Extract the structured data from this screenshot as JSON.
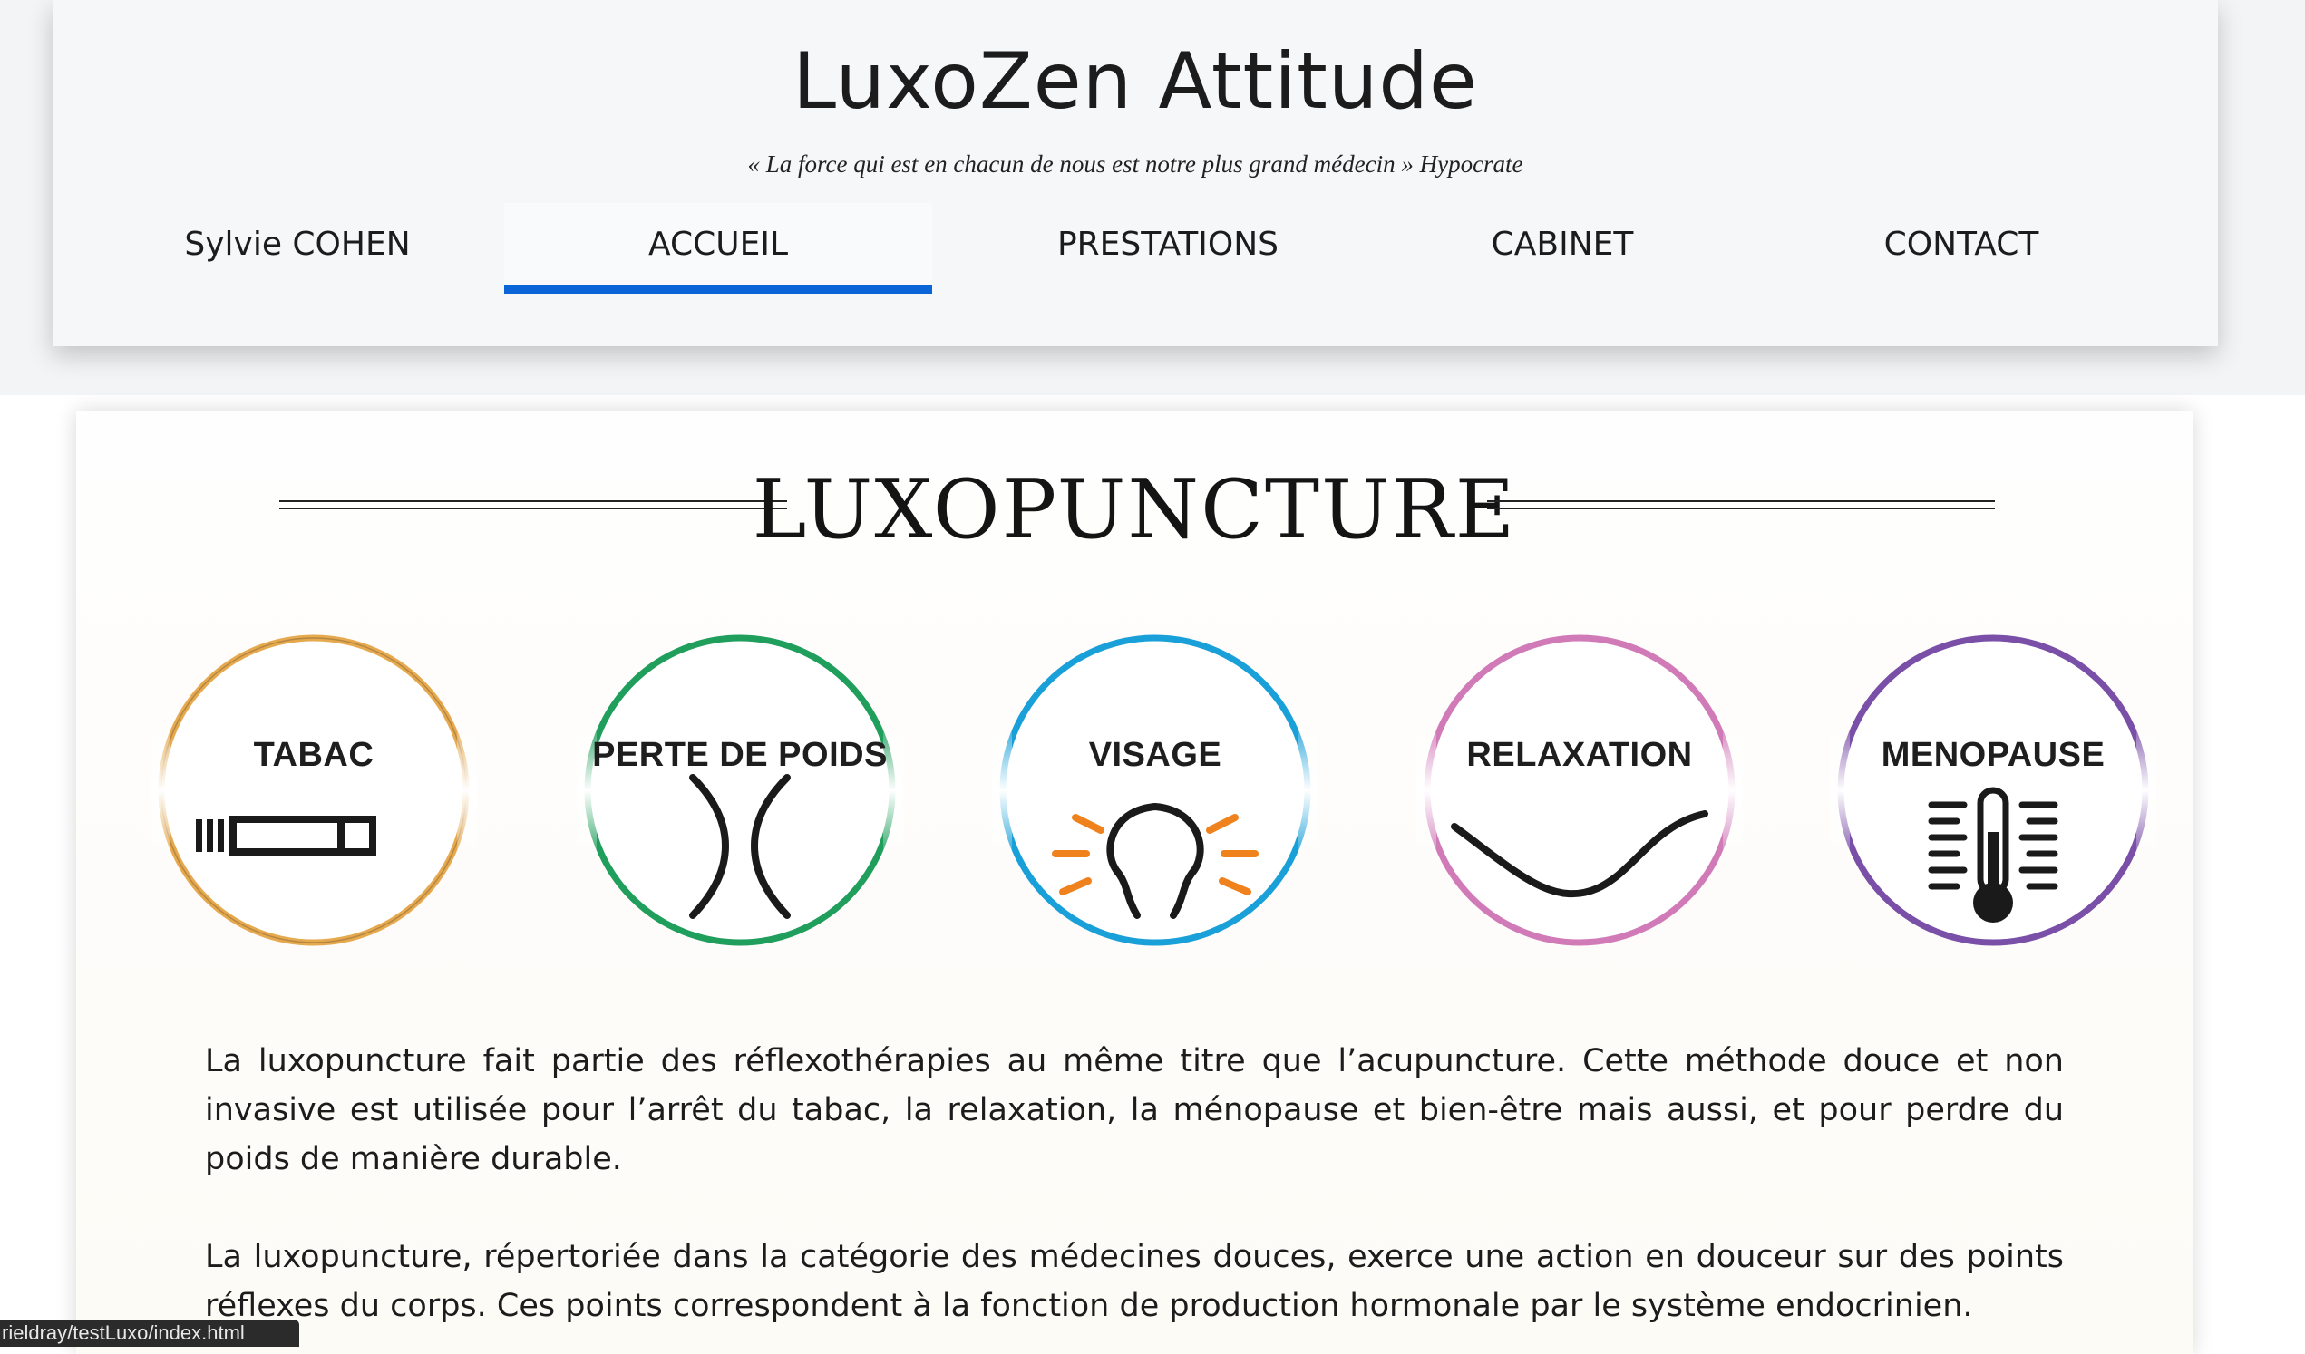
{
  "header": {
    "title": "LuxoZen Attitude",
    "tagline": "« La force qui est en chacun de nous est notre plus grand médecin » Hypocrate"
  },
  "nav": {
    "items": [
      {
        "label": "Sylvie COHEN",
        "active": false
      },
      {
        "label": "ACCUEIL",
        "active": true
      },
      {
        "label": "PRESTATIONS",
        "active": false
      },
      {
        "label": "CABINET",
        "active": false
      },
      {
        "label": "CONTACT",
        "active": false
      }
    ],
    "active_color": "#0a66d8"
  },
  "section": {
    "title": "LUXOPUNCTURE",
    "services": [
      {
        "label": "TABAC",
        "icon": "cigarette-icon",
        "color": "#e6a94e"
      },
      {
        "label": "PERTE DE POIDS",
        "icon": "waist-icon",
        "color": "#1f9e5c"
      },
      {
        "label": "VISAGE",
        "icon": "face-glow-icon",
        "color": "#1aa0d8",
        "accent": "#f0821e"
      },
      {
        "label": "RELAXATION",
        "icon": "wave-icon",
        "color": "#d17ab8"
      },
      {
        "label": "MENOPAUSE",
        "icon": "thermometer-icon",
        "color": "#7a4fa8"
      }
    ],
    "paragraphs": [
      "La luxopuncture fait partie des réflexothérapies au même titre que l’acupuncture. Cette méthode douce et non invasive est utilisée pour l’arrêt du tabac, la relaxation, la ménopause et bien-être mais aussi, et pour perdre du poids de manière durable.",
      "La luxopuncture, répertoriée dans la catégorie des médecines douces, exerce une action en douceur sur des points réflexes du corps. Ces points correspondent à la fonction de production hormonale par le système endocrinien."
    ]
  },
  "status_bar": {
    "url": "rieldray/testLuxo/index.html"
  }
}
